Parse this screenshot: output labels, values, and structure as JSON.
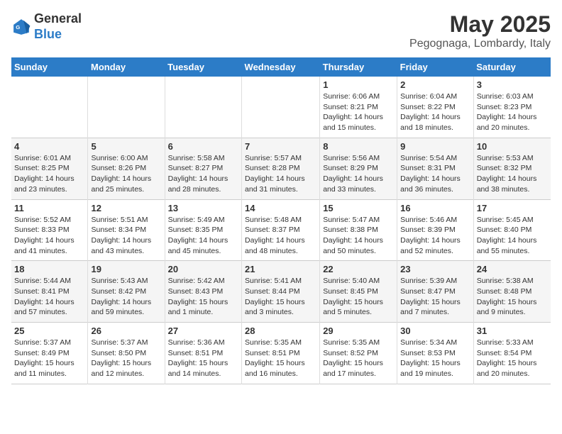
{
  "header": {
    "logo_general": "General",
    "logo_blue": "Blue",
    "month_year": "May 2025",
    "location": "Pegognaga, Lombardy, Italy"
  },
  "days_of_week": [
    "Sunday",
    "Monday",
    "Tuesday",
    "Wednesday",
    "Thursday",
    "Friday",
    "Saturday"
  ],
  "weeks": [
    [
      {
        "num": "",
        "detail": ""
      },
      {
        "num": "",
        "detail": ""
      },
      {
        "num": "",
        "detail": ""
      },
      {
        "num": "",
        "detail": ""
      },
      {
        "num": "1",
        "detail": "Sunrise: 6:06 AM\nSunset: 8:21 PM\nDaylight: 14 hours\nand 15 minutes."
      },
      {
        "num": "2",
        "detail": "Sunrise: 6:04 AM\nSunset: 8:22 PM\nDaylight: 14 hours\nand 18 minutes."
      },
      {
        "num": "3",
        "detail": "Sunrise: 6:03 AM\nSunset: 8:23 PM\nDaylight: 14 hours\nand 20 minutes."
      }
    ],
    [
      {
        "num": "4",
        "detail": "Sunrise: 6:01 AM\nSunset: 8:25 PM\nDaylight: 14 hours\nand 23 minutes."
      },
      {
        "num": "5",
        "detail": "Sunrise: 6:00 AM\nSunset: 8:26 PM\nDaylight: 14 hours\nand 25 minutes."
      },
      {
        "num": "6",
        "detail": "Sunrise: 5:58 AM\nSunset: 8:27 PM\nDaylight: 14 hours\nand 28 minutes."
      },
      {
        "num": "7",
        "detail": "Sunrise: 5:57 AM\nSunset: 8:28 PM\nDaylight: 14 hours\nand 31 minutes."
      },
      {
        "num": "8",
        "detail": "Sunrise: 5:56 AM\nSunset: 8:29 PM\nDaylight: 14 hours\nand 33 minutes."
      },
      {
        "num": "9",
        "detail": "Sunrise: 5:54 AM\nSunset: 8:31 PM\nDaylight: 14 hours\nand 36 minutes."
      },
      {
        "num": "10",
        "detail": "Sunrise: 5:53 AM\nSunset: 8:32 PM\nDaylight: 14 hours\nand 38 minutes."
      }
    ],
    [
      {
        "num": "11",
        "detail": "Sunrise: 5:52 AM\nSunset: 8:33 PM\nDaylight: 14 hours\nand 41 minutes."
      },
      {
        "num": "12",
        "detail": "Sunrise: 5:51 AM\nSunset: 8:34 PM\nDaylight: 14 hours\nand 43 minutes."
      },
      {
        "num": "13",
        "detail": "Sunrise: 5:49 AM\nSunset: 8:35 PM\nDaylight: 14 hours\nand 45 minutes."
      },
      {
        "num": "14",
        "detail": "Sunrise: 5:48 AM\nSunset: 8:37 PM\nDaylight: 14 hours\nand 48 minutes."
      },
      {
        "num": "15",
        "detail": "Sunrise: 5:47 AM\nSunset: 8:38 PM\nDaylight: 14 hours\nand 50 minutes."
      },
      {
        "num": "16",
        "detail": "Sunrise: 5:46 AM\nSunset: 8:39 PM\nDaylight: 14 hours\nand 52 minutes."
      },
      {
        "num": "17",
        "detail": "Sunrise: 5:45 AM\nSunset: 8:40 PM\nDaylight: 14 hours\nand 55 minutes."
      }
    ],
    [
      {
        "num": "18",
        "detail": "Sunrise: 5:44 AM\nSunset: 8:41 PM\nDaylight: 14 hours\nand 57 minutes."
      },
      {
        "num": "19",
        "detail": "Sunrise: 5:43 AM\nSunset: 8:42 PM\nDaylight: 14 hours\nand 59 minutes."
      },
      {
        "num": "20",
        "detail": "Sunrise: 5:42 AM\nSunset: 8:43 PM\nDaylight: 15 hours\nand 1 minute."
      },
      {
        "num": "21",
        "detail": "Sunrise: 5:41 AM\nSunset: 8:44 PM\nDaylight: 15 hours\nand 3 minutes."
      },
      {
        "num": "22",
        "detail": "Sunrise: 5:40 AM\nSunset: 8:45 PM\nDaylight: 15 hours\nand 5 minutes."
      },
      {
        "num": "23",
        "detail": "Sunrise: 5:39 AM\nSunset: 8:47 PM\nDaylight: 15 hours\nand 7 minutes."
      },
      {
        "num": "24",
        "detail": "Sunrise: 5:38 AM\nSunset: 8:48 PM\nDaylight: 15 hours\nand 9 minutes."
      }
    ],
    [
      {
        "num": "25",
        "detail": "Sunrise: 5:37 AM\nSunset: 8:49 PM\nDaylight: 15 hours\nand 11 minutes."
      },
      {
        "num": "26",
        "detail": "Sunrise: 5:37 AM\nSunset: 8:50 PM\nDaylight: 15 hours\nand 12 minutes."
      },
      {
        "num": "27",
        "detail": "Sunrise: 5:36 AM\nSunset: 8:51 PM\nDaylight: 15 hours\nand 14 minutes."
      },
      {
        "num": "28",
        "detail": "Sunrise: 5:35 AM\nSunset: 8:51 PM\nDaylight: 15 hours\nand 16 minutes."
      },
      {
        "num": "29",
        "detail": "Sunrise: 5:35 AM\nSunset: 8:52 PM\nDaylight: 15 hours\nand 17 minutes."
      },
      {
        "num": "30",
        "detail": "Sunrise: 5:34 AM\nSunset: 8:53 PM\nDaylight: 15 hours\nand 19 minutes."
      },
      {
        "num": "31",
        "detail": "Sunrise: 5:33 AM\nSunset: 8:54 PM\nDaylight: 15 hours\nand 20 minutes."
      }
    ]
  ]
}
